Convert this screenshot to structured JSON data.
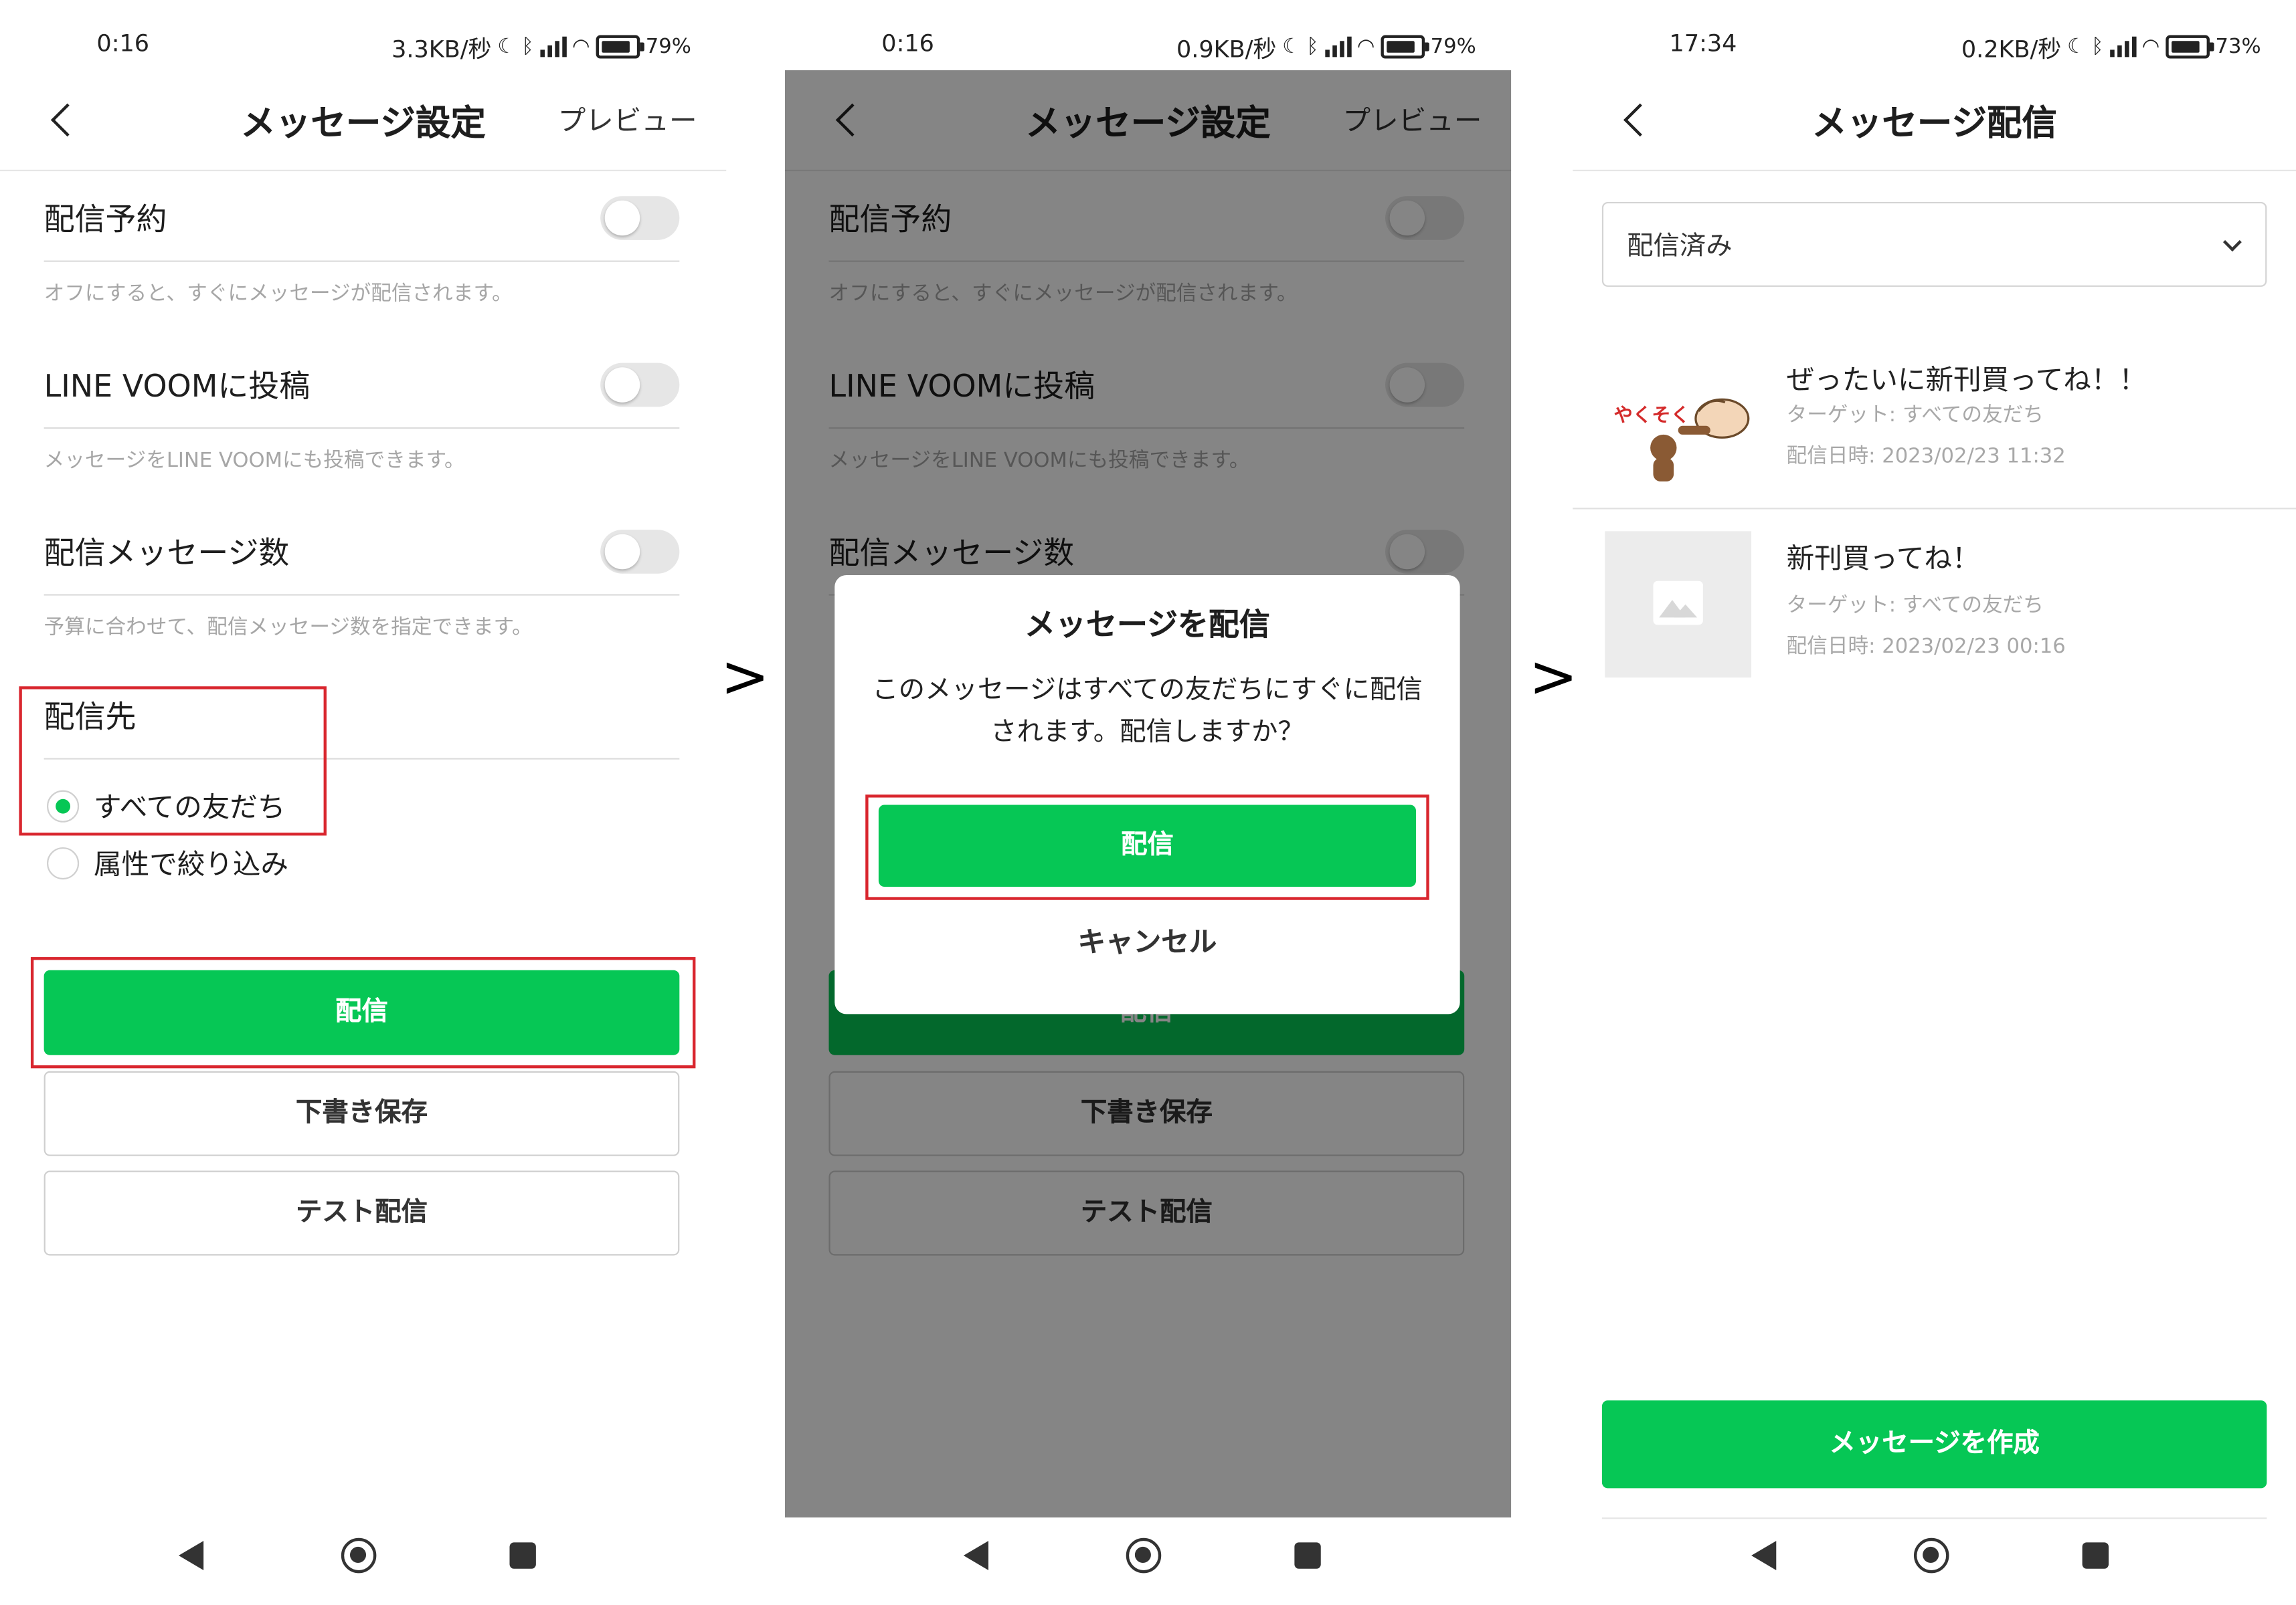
{
  "separator": ">",
  "screen1": {
    "status": {
      "time": "0:16",
      "speed": "3.3KB/秒",
      "battery": "79"
    },
    "title": "メッセージ設定",
    "preview": "プレビュー",
    "settings": [
      {
        "label": "配信予約",
        "hint": "オフにすると、すぐにメッセージが配信されます。"
      },
      {
        "label": "LINE VOOMに投稿",
        "hint": "メッセージをLINE VOOMにも投稿できます。"
      },
      {
        "label": "配信メッセージ数",
        "hint": "予算に合わせて、配信メッセージ数を指定できます。"
      }
    ],
    "target_heading": "配信先",
    "radio_all": "すべての友だち",
    "radio_attr": "属性で絞り込み",
    "send": "配信",
    "save_draft": "下書き保存",
    "test_send": "テスト配信"
  },
  "screen2": {
    "status": {
      "time": "0:16",
      "speed": "0.9KB/秒",
      "battery": "79"
    },
    "dialog": {
      "title": "メッセージを配信",
      "body": "このメッセージはすべての友だちにすぐに配信されます。配信しますか？",
      "ok": "配信",
      "cancel": "キャンセル"
    }
  },
  "screen3": {
    "status": {
      "time": "17:34",
      "speed": "0.2KB/秒",
      "battery": "73"
    },
    "title": "メッセージ配信",
    "filter": "配信済み",
    "messages": [
      {
        "title": "ぜったいに新刊買ってね！！",
        "target": "ターゲット: すべての友だち",
        "date": "配信日時: 2023/02/23 11:32",
        "sticker_text": "やくそく"
      },
      {
        "title": "新刊買ってね！",
        "target": "ターゲット: すべての友だち",
        "date": "配信日時: 2023/02/23 00:16"
      }
    ],
    "create": "メッセージを作成"
  },
  "colors": {
    "line_green": "#06c755",
    "highlight_red": "#d9262e"
  },
  "icons": [
    "back-arrow-icon",
    "moon-icon",
    "bluetooth-icon",
    "volte-icon",
    "signal-icon",
    "wifi-icon",
    "battery-icon",
    "chevron-down-icon",
    "image-placeholder-icon",
    "sys-back-icon",
    "sys-home-icon",
    "sys-recent-icon"
  ]
}
